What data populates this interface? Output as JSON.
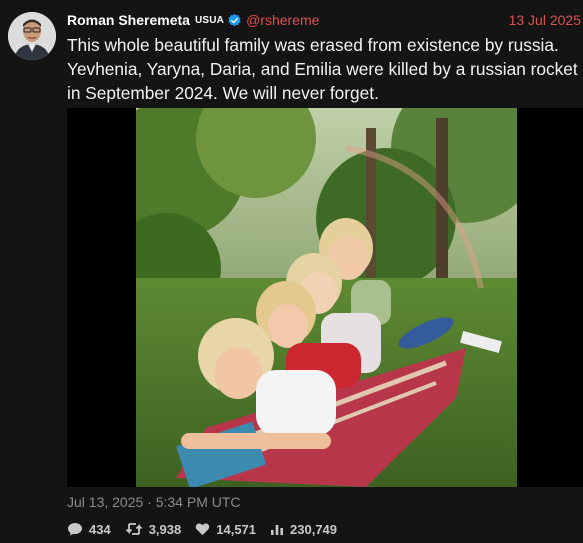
{
  "author": {
    "name": "Roman Sheremeta",
    "tag": "USUA",
    "handle": "@rshereme"
  },
  "post": {
    "date_short": "13 Jul 2025",
    "text": "This whole beautiful family was erased from existence by russia. Yevhenia, Yaryna, Daria, and Emilia were killed by a russian rocket in September 2024. We will never forget.",
    "timestamp": "Jul 13, 2025 · 5:34 PM UTC"
  },
  "stats": {
    "replies": "434",
    "retweets": "3,938",
    "likes": "14,571",
    "views": "230,749"
  },
  "icons": [
    "verified-icon",
    "reply-icon",
    "retweet-icon",
    "like-icon",
    "views-icon"
  ],
  "colors": {
    "accent": "#e0504f",
    "background": "#141414",
    "verified": "#1d9bf0"
  }
}
